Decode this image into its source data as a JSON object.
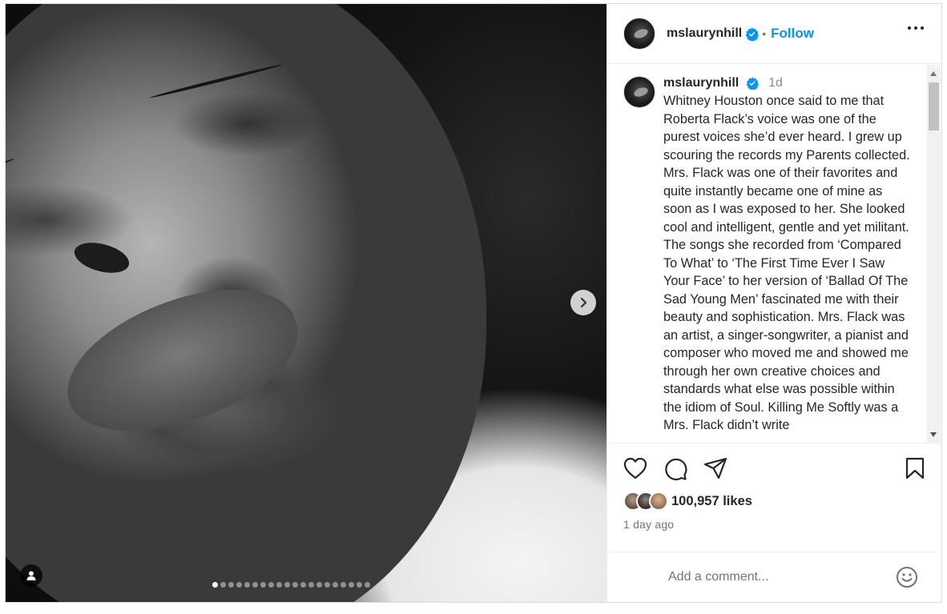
{
  "post": {
    "username": "mslaurynhill",
    "follow_label": "Follow",
    "separator": "•",
    "caption": {
      "username": "mslaurynhill",
      "time": "1d",
      "text": "Whitney Houston once said to me that Roberta Flack’s voice was one of the purest voices she’d ever heard. I grew up scouring the records my Parents collected. Mrs. Flack was one of their favorites and quite instantly became one of mine as soon as I was exposed to her. She looked cool and intelligent, gentle and yet militant. The songs she recorded from ‘Compared To What’ to ‘The First Time Ever I Saw Your Face’ to her version of ‘Ballad Of The Sad Young Men’ fascinated me with their beauty and sophistication. Mrs. Flack was an artist, a singer-songwriter, a pianist and composer who moved me and showed me through her own creative choices and standards what else was possible within the idiom of Soul. Killing Me Softly was a Mrs. Flack didn’t write"
    },
    "likes": "100,957 likes",
    "posted_ago": "1 day ago",
    "comment_placeholder": "Add a comment...",
    "carousel": {
      "total_slides": 20,
      "active_index": 0
    }
  },
  "icons": {
    "more": "more-options-icon",
    "verified": "verified-badge-icon",
    "like": "heart-icon",
    "comment": "comment-icon",
    "share": "share-icon",
    "save": "bookmark-icon",
    "next": "chevron-right-icon",
    "tags": "user-tag-icon",
    "emoji": "emoji-icon"
  },
  "colors": {
    "accent": "#0095f6",
    "verified": "#0095f6",
    "text": "#262626",
    "muted": "#737373"
  }
}
